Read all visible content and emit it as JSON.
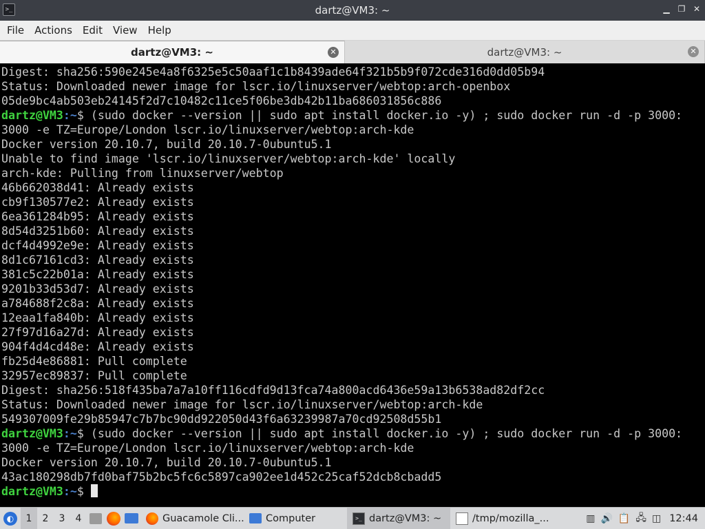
{
  "window": {
    "title": "dartz@VM3: ~",
    "controls": [
      "minimize",
      "maximize",
      "close"
    ]
  },
  "menubar": [
    "File",
    "Actions",
    "Edit",
    "View",
    "Help"
  ],
  "tabs": [
    {
      "label": "dartz@VM3: ~",
      "active": true
    },
    {
      "label": "dartz@VM3: ~",
      "active": false
    }
  ],
  "terminal": {
    "prompt_user": "dartz@VM3",
    "prompt_path": ":~",
    "lines": [
      {
        "type": "out",
        "text": "Digest: sha256:590e245e4a8f6325e5c50aaf1c1b8439ade64f321b5b9f072cde316d0dd05b94"
      },
      {
        "type": "out",
        "text": "Status: Downloaded newer image for lscr.io/linuxserver/webtop:arch-openbox"
      },
      {
        "type": "out",
        "text": "05de9bc4ab503eb24145f2d7c10482c11ce5f06be3db42b11ba686031856c886"
      },
      {
        "type": "cmd",
        "text": "$ (sudo docker --version || sudo apt install docker.io -y) ; sudo docker run -d -p 3000:"
      },
      {
        "type": "out",
        "text": "3000 -e TZ=Europe/London lscr.io/linuxserver/webtop:arch-kde"
      },
      {
        "type": "out",
        "text": "Docker version 20.10.7, build 20.10.7-0ubuntu5.1"
      },
      {
        "type": "out",
        "text": "Unable to find image 'lscr.io/linuxserver/webtop:arch-kde' locally"
      },
      {
        "type": "out",
        "text": "arch-kde: Pulling from linuxserver/webtop"
      },
      {
        "type": "out",
        "text": "46b662038d41: Already exists"
      },
      {
        "type": "out",
        "text": "cb9f130577e2: Already exists"
      },
      {
        "type": "out",
        "text": "6ea361284b95: Already exists"
      },
      {
        "type": "out",
        "text": "8d54d3251b60: Already exists"
      },
      {
        "type": "out",
        "text": "dcf4d4992e9e: Already exists"
      },
      {
        "type": "out",
        "text": "8d1c67161cd3: Already exists"
      },
      {
        "type": "out",
        "text": "381c5c22b01a: Already exists"
      },
      {
        "type": "out",
        "text": "9201b33d53d7: Already exists"
      },
      {
        "type": "out",
        "text": "a784688f2c8a: Already exists"
      },
      {
        "type": "out",
        "text": "12eaa1fa840b: Already exists"
      },
      {
        "type": "out",
        "text": "27f97d16a27d: Already exists"
      },
      {
        "type": "out",
        "text": "904f4d4cd48e: Already exists"
      },
      {
        "type": "out",
        "text": "fb25d4e86881: Pull complete"
      },
      {
        "type": "out",
        "text": "32957ec89837: Pull complete"
      },
      {
        "type": "out",
        "text": "Digest: sha256:518f435ba7a7a10ff116cdfd9d13fca74a800acd6436e59a13b6538ad82df2cc"
      },
      {
        "type": "out",
        "text": "Status: Downloaded newer image for lscr.io/linuxserver/webtop:arch-kde"
      },
      {
        "type": "out",
        "text": "549307009fe29b85947c7b7bc90dd922050d43f6a63239987a70cd92508d55b1"
      },
      {
        "type": "cmd",
        "text": "$ (sudo docker --version || sudo apt install docker.io -y) ; sudo docker run -d -p 3000:"
      },
      {
        "type": "out",
        "text": "3000 -e TZ=Europe/London lscr.io/linuxserver/webtop:arch-kde"
      },
      {
        "type": "out",
        "text": "Docker version 20.10.7, build 20.10.7-0ubuntu5.1"
      },
      {
        "type": "out",
        "text": "43ac180298db7fd0baf75b2bc5fc6c5897ca902ee1d452c25caf52dcb8cbadd5"
      },
      {
        "type": "prompt",
        "text": "$ "
      }
    ]
  },
  "taskbar": {
    "workspaces": [
      "1",
      "2",
      "3",
      "4"
    ],
    "tasks": [
      {
        "label": "Guacamole Cli...",
        "icon": "firefox-icon"
      },
      {
        "label": "Computer",
        "icon": "folder-icon"
      },
      {
        "label": "dartz@VM3: ~",
        "icon": "terminal-icon",
        "active": true
      },
      {
        "label": "/tmp/mozilla_...",
        "icon": "text-editor-icon"
      }
    ],
    "clock": "12:44"
  }
}
